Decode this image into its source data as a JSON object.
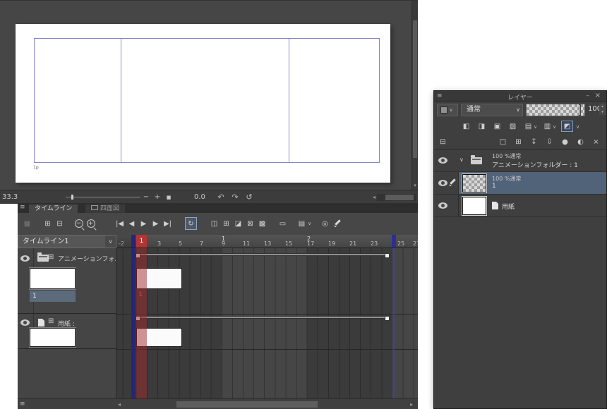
{
  "colors": {
    "accent_red": "#b23533",
    "marker_blue": "#2e2e96",
    "selection_blue": "#506379"
  },
  "canvas": {
    "page_label": "1p"
  },
  "statusbar": {
    "zoom_value": "33.3",
    "rotate_value": "0.0",
    "minus": "−",
    "plus": "+",
    "stop": "■",
    "undo": "↶",
    "redo": "↷",
    "reset": "↺",
    "scroll_left": "◂",
    "scroll_down": "▾"
  },
  "timeline": {
    "menu_icon": "≡",
    "tabs": [
      {
        "label": "タイムライン"
      },
      {
        "label": "四面図"
      }
    ],
    "toolbar": {
      "new_timeline": "▦",
      "insert_frame": "⊞",
      "delete_frame": "⊟",
      "zoom_out": "−",
      "zoom_in": "+",
      "go_start": "|◀",
      "prev_frame": "◀",
      "play": "▶",
      "next_frame": "▶",
      "go_end": "▶|",
      "loop": "↻",
      "new_cel": "◫",
      "new_cel_folder": "⊞",
      "specify_cel": "◪",
      "delete_cel": "⊠",
      "batch_change": "▩",
      "edit_track": "▭",
      "track_options": "▤",
      "chevron": "∨",
      "onion_skin": "◎"
    },
    "name_select": {
      "value": "タイムライン1",
      "chevron": "∨"
    },
    "ruler": {
      "preroll": "-2",
      "playhead": "1",
      "seconds": [
        "1",
        "2"
      ],
      "frames": [
        "3",
        "5",
        "7",
        "9",
        "11",
        "13",
        "15",
        "17",
        "19",
        "21",
        "23",
        "25",
        "27"
      ]
    },
    "tracks": [
      {
        "label": "アニメーションフォルダ",
        "expand": "⊞",
        "cel_number": "1",
        "timeline_number": "1"
      },
      {
        "label": "用紙 :",
        "expand": "⊞"
      }
    ],
    "scrollbar": {
      "menu": "≡",
      "left": "◂",
      "right": "▸"
    }
  },
  "layer_panel": {
    "menu_icon": "≡",
    "title": "レイヤー",
    "minimize": "–",
    "close": "×",
    "blend_mode": "通常",
    "blend_chevron": "∨",
    "opacity": "100",
    "spin_up": "▴",
    "spin_down": "▾",
    "combine_chevron": "∨",
    "property_icons": {
      "clip": "◧",
      "reference": "◨",
      "lock": "▣",
      "lock_transparent": "▨",
      "mask": "▤",
      "ruler": "▥",
      "layer_color": "◩",
      "chevron": "∨"
    },
    "command_icons": {
      "view": "⊟",
      "new_raster": "□",
      "new_folder": "⊞",
      "transfer": "↧",
      "merge": "⇩",
      "mask": "●",
      "apply_mask": "◐",
      "delete": "×"
    },
    "rows": [
      {
        "expand": "∨",
        "line1": "100 %通常",
        "line2": "アニメーションフォルダー : 1"
      },
      {
        "line1": "100 %通常",
        "line2": "1"
      },
      {
        "name": "用紙"
      }
    ]
  }
}
